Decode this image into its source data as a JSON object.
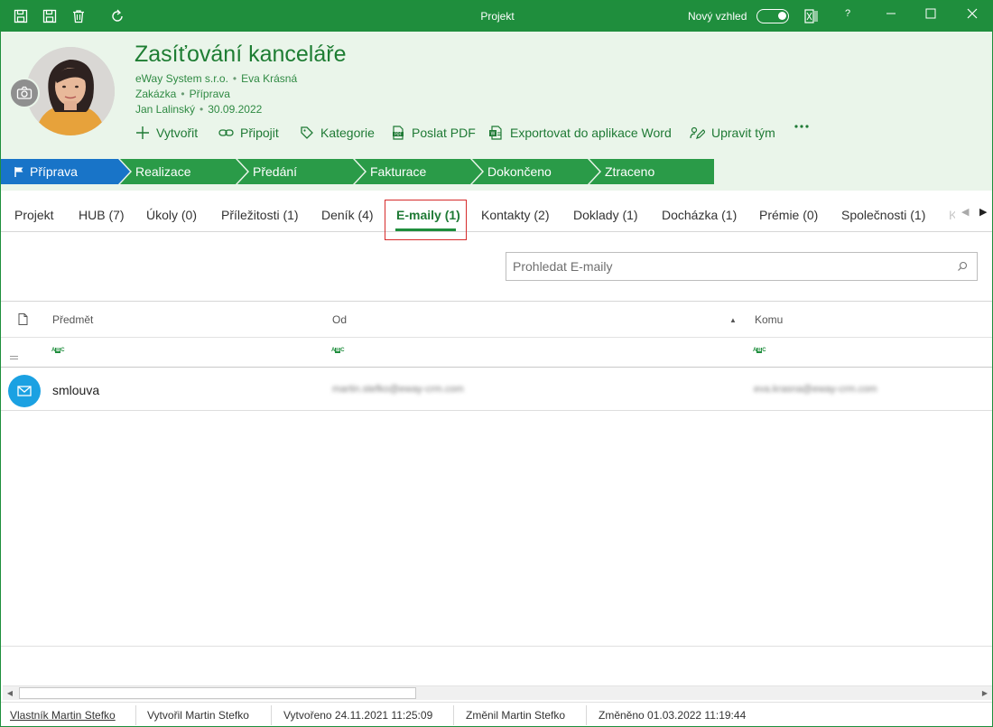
{
  "titlebar": {
    "title": "Projekt",
    "new_look_label": "Nový vzhled",
    "help_label": "?",
    "icons": [
      "save-close-icon",
      "save-icon",
      "delete-icon",
      "refresh-icon",
      "layout-icon"
    ]
  },
  "record": {
    "title": "Zasíťování kanceláře",
    "meta_line1": [
      "eWay System s.r.o.",
      "Eva Krásná"
    ],
    "meta_line2": [
      "Zakázka",
      "Příprava"
    ],
    "meta_line3": [
      "Jan Lalinský",
      "30.09.2022"
    ]
  },
  "actions": [
    {
      "label": "Vytvořit",
      "icon": "plus-icon"
    },
    {
      "label": "Připojit",
      "icon": "link-icon"
    },
    {
      "label": "Kategorie",
      "icon": "tag-icon"
    },
    {
      "label": "Poslat PDF",
      "icon": "pdf-icon"
    },
    {
      "label": "Exportovat do aplikace Word",
      "icon": "word-export-icon"
    },
    {
      "label": "Upravit tým",
      "icon": "team-edit-icon"
    }
  ],
  "stages": [
    {
      "label": "Příprava",
      "active": true
    },
    {
      "label": "Realizace",
      "active": false
    },
    {
      "label": "Předání",
      "active": false
    },
    {
      "label": "Fakturace",
      "active": false
    },
    {
      "label": "Dokončeno",
      "active": false
    },
    {
      "label": "Ztraceno",
      "active": false
    }
  ],
  "tabs": [
    {
      "label": "Projekt"
    },
    {
      "label": "HUB (7)"
    },
    {
      "label": "Úkoly (0)"
    },
    {
      "label": "Příležitosti (1)"
    },
    {
      "label": "Deník (4)"
    },
    {
      "label": "E-maily (1)",
      "active": true
    },
    {
      "label": "Kontakty (2)"
    },
    {
      "label": "Doklady (1)"
    },
    {
      "label": "Docházka (1)"
    },
    {
      "label": "Prémie (0)"
    },
    {
      "label": "Společnosti (1)"
    },
    {
      "label": "K"
    }
  ],
  "search": {
    "placeholder": "Prohledat E-maily"
  },
  "grid": {
    "columns": [
      "Předmět",
      "Od",
      "Komu"
    ],
    "sort_column": "Od",
    "rows": [
      {
        "subject": "smlouva",
        "from": "martin.stefko@eway-crm.com",
        "to": "eva.krasna@eway-crm.com"
      }
    ]
  },
  "status": {
    "owner": "Vlastník Martin Stefko",
    "created_by": "Vytvořil Martin Stefko",
    "created_at": "Vytvořeno 24.11.2021 11:25:09",
    "changed_by": "Změnil Martin Stefko",
    "changed_at": "Změněno 01.03.2022 11:19:44"
  },
  "colors": {
    "accent": "#1f8e3d",
    "header_bg": "#eaf5ea",
    "active_stage": "#1874c8",
    "stage": "#2a9b48",
    "mail_icon": "#1ba1e2"
  }
}
